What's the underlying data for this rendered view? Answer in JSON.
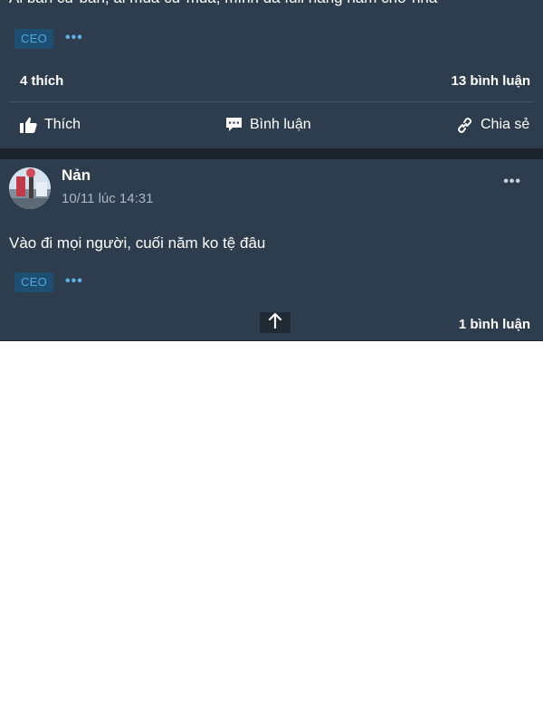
{
  "post1": {
    "text": "Ai bán cứ bán, ai mua cứ mua, mình đã full hàng năm chờ nha",
    "tag": "CEO",
    "likes": "4 thích",
    "comments": "13 bình luận"
  },
  "actions": {
    "like": "Thích",
    "comment": "Bình luận",
    "share": "Chia sẻ"
  },
  "post2": {
    "author": "Nản",
    "time": "10/11 lúc 14:31",
    "text": "Vào đi mọi người, cuối năm ko tệ đâu",
    "tag": "CEO",
    "comments": "1 bình luận"
  },
  "icons": {
    "like": "thumbs-up-icon",
    "comment": "comment-icon",
    "share": "link-icon",
    "more": "more-dots-icon",
    "scroll_top": "arrow-up-icon"
  },
  "colors": {
    "background": "#2d3d4d",
    "tag_bg": "#1e4f73",
    "tag_text": "#4ea8e0",
    "separator": "#1b232b"
  }
}
